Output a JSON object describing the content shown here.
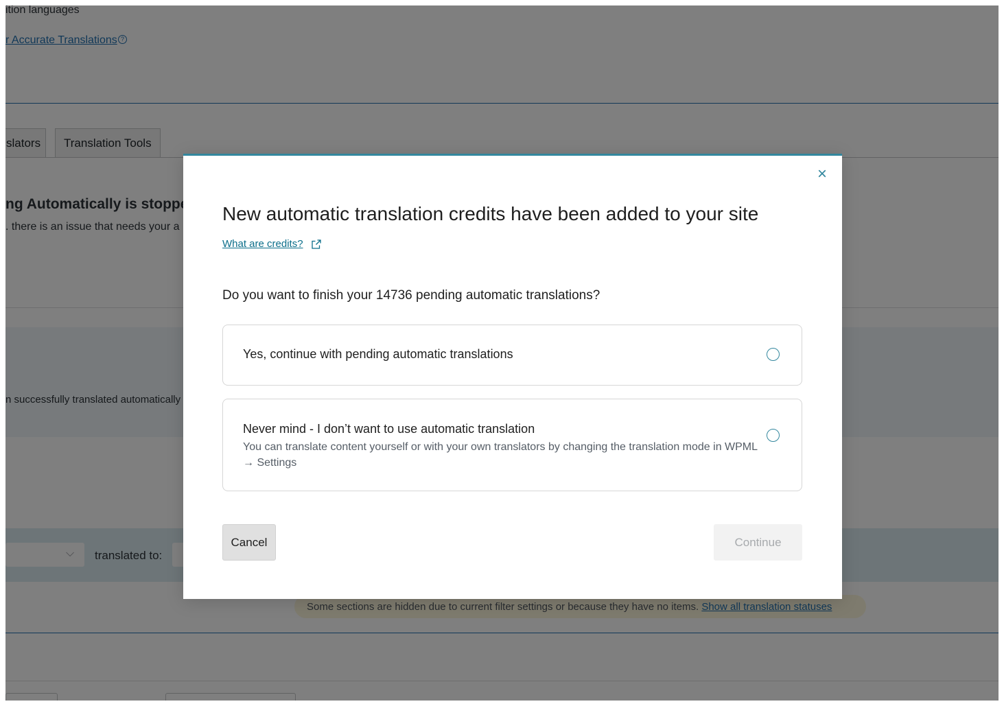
{
  "background": {
    "languages_text": "ition languages",
    "accurate_link": "r Accurate Translations",
    "help_glyph": "?",
    "tabs": [
      "slators",
      "Translation Tools"
    ],
    "stopped_heading": "ng Automatically is stoppe",
    "issue_text": ". there is an issue that needs your a",
    "success_text": "n successfully translated automatically",
    "chevron_glyph": "⌵",
    "translated_to_label": "translated to:",
    "notice": {
      "text": "Some sections are hidden due to current filter settings or because they have no items.",
      "link": "Show all translation statuses"
    }
  },
  "dialog": {
    "close_glyph": "×",
    "title": "New automatic translation credits have been added to your site",
    "credits_link": "What are credits?",
    "question": "Do you want to finish your 14736 pending automatic translations?",
    "options": [
      {
        "title": "Yes, continue with pending automatic translations",
        "description": ""
      },
      {
        "title": "Never mind - I don’t want to use automatic translation",
        "description": "You can translate content yourself or with your own translators by changing the translation mode in WPML → Settings"
      }
    ],
    "cancel_label": "Cancel",
    "continue_label": "Continue"
  },
  "colors": {
    "accent": "#33879e",
    "link": "#0b6e8a",
    "overlay": "rgba(0,0,0,0.5)",
    "disabled_button": "#f2f2f2"
  },
  "icons": {
    "close": "close-icon",
    "external_link": "external-link-icon",
    "radio": "radio-icon",
    "dropdown": "chevron-down-icon",
    "help": "help-icon"
  }
}
